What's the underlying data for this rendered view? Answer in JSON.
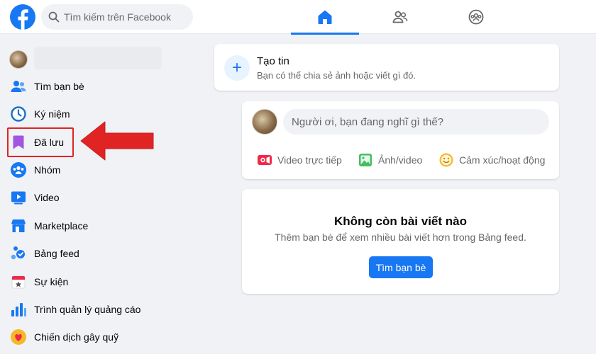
{
  "search": {
    "placeholder": "Tìm kiếm trên Facebook"
  },
  "nav": {
    "tabs": [
      {
        "icon": "home-icon",
        "active": true
      },
      {
        "icon": "friends-icon",
        "active": false
      },
      {
        "icon": "groups-icon",
        "active": false
      }
    ]
  },
  "sidebar": {
    "items": [
      {
        "label": "Tìm bạn bè",
        "icon": "friends-icon"
      },
      {
        "label": "Ký niệm",
        "icon": "memories-clock-icon"
      },
      {
        "label": "Đã lưu",
        "icon": "saved-bookmark-icon"
      },
      {
        "label": "Nhóm",
        "icon": "groups-icon"
      },
      {
        "label": "Video",
        "icon": "video-icon"
      },
      {
        "label": "Marketplace",
        "icon": "marketplace-icon"
      },
      {
        "label": "Bảng feed",
        "icon": "feed-icon"
      },
      {
        "label": "Sự kiện",
        "icon": "events-calendar-icon"
      },
      {
        "label": "Trình quản lý quảng cáo",
        "icon": "ads-manager-icon"
      },
      {
        "label": "Chiến dịch gây quỹ",
        "icon": "fundraiser-heart-icon"
      }
    ]
  },
  "story": {
    "title": "Tạo tin",
    "subtitle": "Bạn có thể chia sẻ ảnh hoặc viết gì đó."
  },
  "composer": {
    "placeholder": "Người ơi, bạn đang nghĩ gì thế?",
    "actions": {
      "live": "Video trực tiếp",
      "photo": "Ảnh/video",
      "feeling": "Cảm xúc/hoạt động"
    }
  },
  "empty_feed": {
    "title": "Không còn bài viết nào",
    "subtitle": "Thêm bạn bè để xem nhiều bài viết hơn trong Bảng feed.",
    "button": "Tìm bạn bè"
  },
  "colors": {
    "brand": "#1877f2",
    "highlight": "#e02424",
    "background": "#f0f2f5"
  }
}
